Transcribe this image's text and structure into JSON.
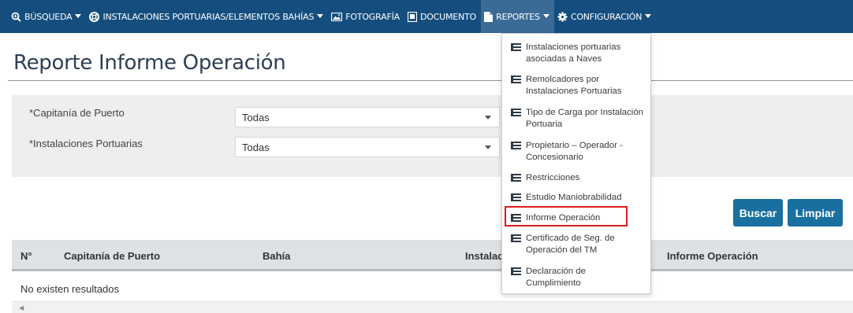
{
  "navbar": {
    "items": [
      {
        "label": "BÚSQUEDA",
        "icon": "search-icon",
        "caret": true
      },
      {
        "label": "INSTALACIONES PORTUARIAS/ELEMENTOS BAHÍAS",
        "icon": "lifebuoy-icon",
        "caret": true
      },
      {
        "label": "FOTOGRAFÍA",
        "icon": "image-icon",
        "caret": false
      },
      {
        "label": "DOCUMENTO",
        "icon": "document-icon",
        "caret": false
      },
      {
        "label": "REPORTES",
        "icon": "file-icon",
        "caret": true
      },
      {
        "label": "CONFIGURACIÓN",
        "icon": "gear-icon",
        "caret": true
      }
    ]
  },
  "page": {
    "title": "Reporte Informe Operación"
  },
  "filters": {
    "capitania_label": "*Capitanía de Puerto",
    "capitania_value": "Todas",
    "instalaciones_label": "*Instalaciones Portuarias",
    "instalaciones_value": "Todas"
  },
  "buttons": {
    "search_label": "Buscar",
    "clear_label": "Limpiar"
  },
  "table": {
    "columns": [
      "N°",
      "Capitanía de Puerto",
      "Bahía",
      "Instalac",
      "Informe Operación"
    ],
    "empty_text": "No existen resultados"
  },
  "reportes_menu": {
    "items": [
      {
        "lines": [
          "Instalaciones portuarias",
          "asociadas a Naves"
        ]
      },
      {
        "lines": [
          "Remolcadores por",
          "Instalaciones Portuarias"
        ]
      },
      {
        "lines": [
          "Tipo de Carga por Instalación",
          "Portuaria"
        ]
      },
      {
        "lines": [
          "Propietario – Operador -",
          "Concesionario"
        ]
      },
      {
        "lines": [
          "Restricciones"
        ]
      },
      {
        "lines": [
          "Estudio Maniobrabilidad"
        ]
      },
      {
        "lines": [
          "Informe Operación"
        ]
      },
      {
        "lines": [
          "Certificado de Seg. de",
          "Operación del TM"
        ]
      },
      {
        "lines": [
          "Declaración de",
          "Cumplimiento"
        ]
      }
    ],
    "selected_label": "Informe Operación"
  },
  "colors": {
    "navbar": "#154e7e",
    "accent": "#1a6fa1",
    "highlight": "#dd1a1a"
  }
}
